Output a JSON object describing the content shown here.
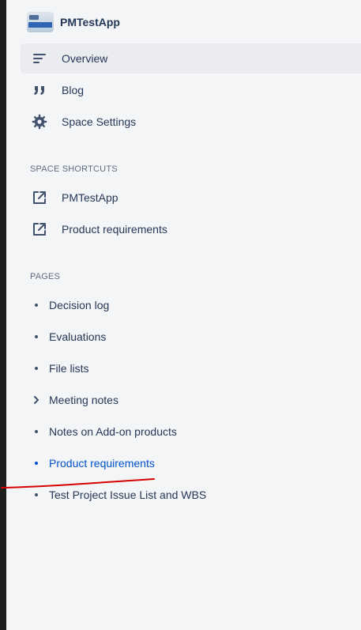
{
  "space": {
    "name": "PMTestApp",
    "logo": "space-logo"
  },
  "nav": [
    {
      "label": "Overview",
      "icon": "overview-icon",
      "active": true
    },
    {
      "label": "Blog",
      "icon": "quote-icon"
    },
    {
      "label": "Space Settings",
      "icon": "gear-icon"
    }
  ],
  "shortcuts": {
    "title": "SPACE SHORTCUTS",
    "items": [
      {
        "label": "PMTestApp",
        "icon": "external-link-icon"
      },
      {
        "label": "Product requirements",
        "icon": "external-link-icon"
      }
    ]
  },
  "pages": {
    "title": "PAGES",
    "items": [
      {
        "label": "Decision log",
        "marker": "bullet"
      },
      {
        "label": "Evaluations",
        "marker": "bullet"
      },
      {
        "label": "File lists",
        "marker": "bullet"
      },
      {
        "label": "Meeting notes",
        "marker": "chevron-right"
      },
      {
        "label": "Notes on Add-on products",
        "marker": "bullet"
      },
      {
        "label": "Product requirements",
        "marker": "bullet",
        "current": true
      },
      {
        "label": "Test Project Issue List and WBS",
        "marker": "bullet"
      }
    ]
  },
  "colors": {
    "sidebar_bg": "#f4f5f7",
    "text": "#253858",
    "link": "#0052cc",
    "annotation": "#d50000"
  }
}
